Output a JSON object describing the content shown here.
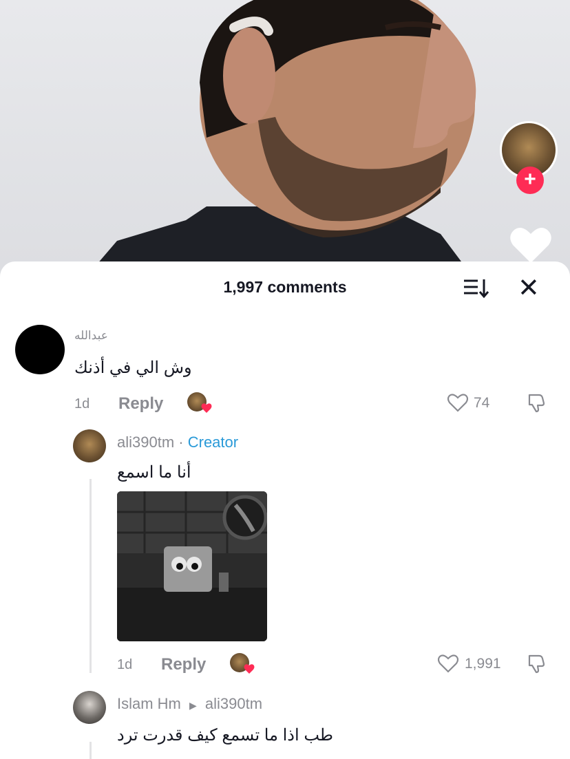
{
  "sheet": {
    "comment_count_label": "1,997 comments"
  },
  "comments": [
    {
      "username": "عبدالله",
      "text": "وش الي في أذنك",
      "time": "1d",
      "reply_label": "Reply",
      "likes": "74"
    },
    {
      "username": "ali390tm",
      "separator": "·",
      "badge": "Creator",
      "text": "أنا ما اسمع",
      "time": "1d",
      "reply_label": "Reply",
      "likes": "1,991",
      "media": "gif"
    },
    {
      "username": "Islam Hm",
      "reply_to": "ali390tm",
      "text": "طب اذا ما تسمع كيف قدرت ترد"
    }
  ],
  "icons": {
    "sort": "sort-icon",
    "close": "close-icon",
    "like": "heart-outline-icon",
    "dislike": "dislike-icon",
    "follow": "plus-icon",
    "creator_liked": "heart-badge-icon"
  },
  "colors": {
    "accent": "#fe2c55",
    "creator": "#2a9ad8",
    "muted": "#8a8b91",
    "text": "#161823"
  }
}
